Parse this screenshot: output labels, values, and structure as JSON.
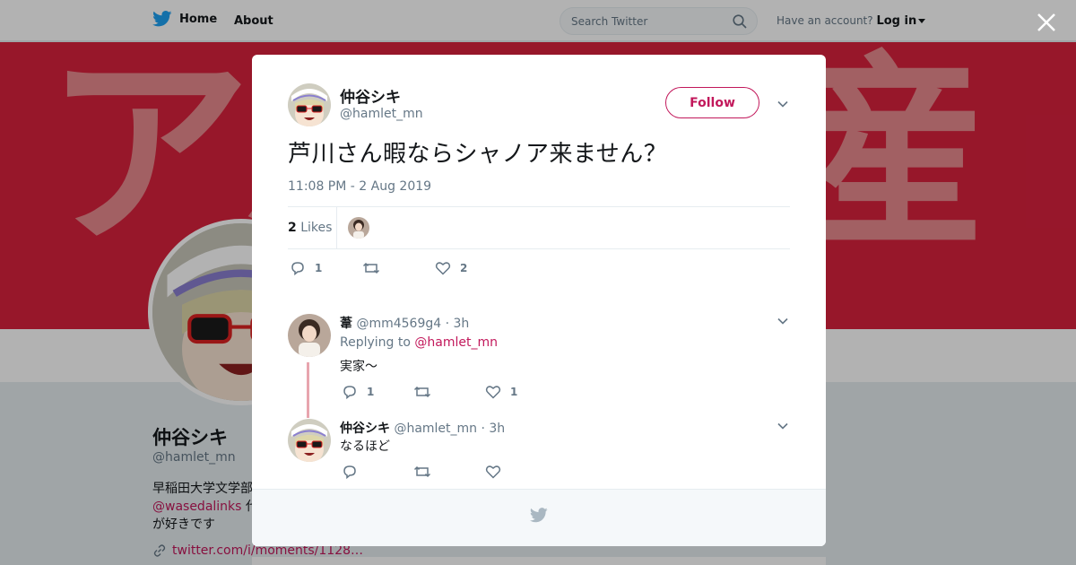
{
  "topbar": {
    "home_label": "Home",
    "about_label": "About",
    "search_placeholder": "Search Twitter",
    "account_prompt": "Have an account?",
    "login_label": "Log in"
  },
  "profile": {
    "name": "仲谷シキ",
    "handle": "@hamlet_mn",
    "bio_line1": "早稲田大学文学部",
    "bio_link": "@wasedalinks",
    "bio_line2_rest": "代表",
    "bio_line3": "が好きです",
    "url": "twitter.com/i/moments/1128…"
  },
  "tweet": {
    "author_name": "仲谷シキ",
    "author_handle": "@hamlet_mn",
    "follow_label": "Follow",
    "text": "芦川さん暇ならシャノア来ません？",
    "timestamp": "11:08 PM - 2 Aug 2019",
    "likes_count": "2",
    "likes_label": "Likes",
    "reply_count": "1",
    "retweet_count": "",
    "like_count": "2"
  },
  "replies": [
    {
      "name": "葦",
      "handle": "@mm4569g4",
      "time": "· 3h",
      "replying_prefix": "Replying to",
      "replying_to": "@hamlet_mn",
      "text": "実家〜",
      "reply_count": "1",
      "retweet_count": "",
      "like_count": "1"
    },
    {
      "name": "仲谷シキ",
      "handle": "@hamlet_mn",
      "time": "· 3h",
      "text": "なるほど",
      "reply_count": "",
      "retweet_count": "",
      "like_count": ""
    }
  ],
  "colors": {
    "accent": "#c2185b",
    "banner": "#d8213d",
    "twitter_blue": "#1da1f2",
    "muted": "#657786"
  }
}
